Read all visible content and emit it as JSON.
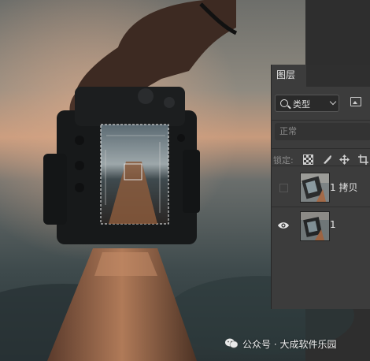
{
  "layers_panel": {
    "tab_label": "图层",
    "filter": {
      "kind_label": "类型",
      "icon": "search-icon"
    },
    "blend_mode": "正常",
    "lock_label": "锁定:",
    "lock_icons": [
      "lock-transparent-pixels-icon",
      "lock-image-pixels-icon",
      "lock-position-icon",
      "lock-artboard-icon"
    ],
    "layers": [
      {
        "name": "1 拷贝",
        "visible": false
      },
      {
        "name": "1",
        "visible": true
      }
    ]
  },
  "watermark": {
    "text": "公众号 · 大成软件乐园",
    "icon": "wechat-icon"
  },
  "colors": {
    "panel_bg": "#3c3c3c",
    "dark_bg": "#2b2b2b",
    "text": "#e6e6e6"
  }
}
